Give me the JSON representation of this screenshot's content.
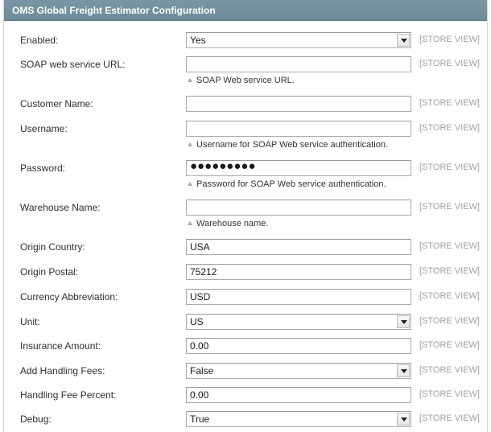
{
  "panel": {
    "title": "OMS Global Freight Estimator Configuration"
  },
  "fields": [
    {
      "label": "Enabled:",
      "type": "select",
      "value": "Yes",
      "scope": "[STORE VIEW]",
      "note": ""
    },
    {
      "label": "SOAP web service URL:",
      "type": "text",
      "value": "",
      "scope": "[STORE VIEW]",
      "note": "SOAP Web service URL."
    },
    {
      "label": "Customer Name:",
      "type": "text",
      "value": "",
      "scope": "[STORE VIEW]",
      "note": ""
    },
    {
      "label": "Username:",
      "type": "text",
      "value": "",
      "scope": "[STORE VIEW]",
      "note": "Username for SOAP Web service authentication."
    },
    {
      "label": "Password:",
      "type": "password",
      "value": "●●●●●●●●●",
      "scope": "[STORE VIEW]",
      "note": "Password for SOAP Web service authentication."
    },
    {
      "label": "Warehouse Name:",
      "type": "text",
      "value": "",
      "scope": "[STORE VIEW]",
      "note": "Warehouse name."
    },
    {
      "label": "Origin Country:",
      "type": "text",
      "value": "USA",
      "scope": "[STORE VIEW]",
      "note": ""
    },
    {
      "label": "Origin Postal:",
      "type": "text",
      "value": "75212",
      "scope": "[STORE VIEW]",
      "note": ""
    },
    {
      "label": "Currency Abbreviation:",
      "type": "text",
      "value": "USD",
      "scope": "[STORE VIEW]",
      "note": ""
    },
    {
      "label": "Unit:",
      "type": "select",
      "value": "US",
      "scope": "[STORE VIEW]",
      "note": ""
    },
    {
      "label": "Insurance Amount:",
      "type": "text",
      "value": "0.00",
      "scope": "[STORE VIEW]",
      "note": ""
    },
    {
      "label": "Add Handling Fees:",
      "type": "select",
      "value": "False",
      "scope": "[STORE VIEW]",
      "note": ""
    },
    {
      "label": "Handling Fee Percent:",
      "type": "text",
      "value": "0.00",
      "scope": "[STORE VIEW]",
      "note": ""
    },
    {
      "label": "Debug:",
      "type": "select",
      "value": "True",
      "scope": "[STORE VIEW]",
      "note": ""
    }
  ]
}
